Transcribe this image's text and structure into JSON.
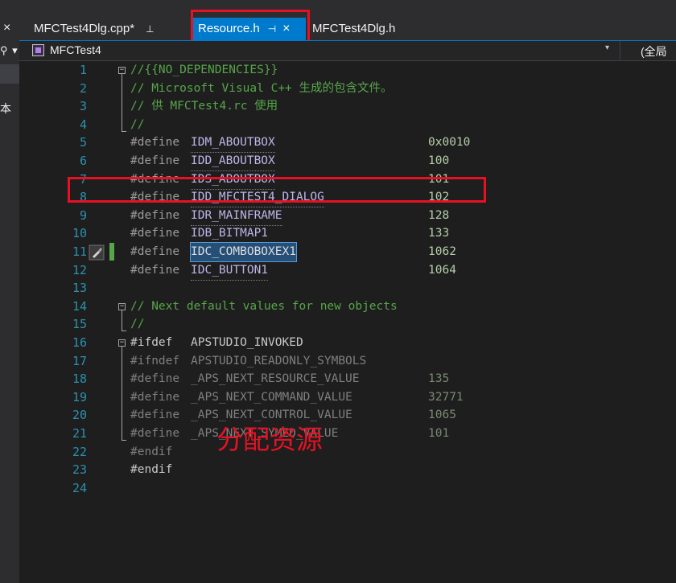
{
  "left_panel": {
    "close_glyph": "×",
    "search_glyph": "⚲ ▾",
    "partial_text": "本"
  },
  "tabs": [
    {
      "label": "MFCTest4Dlg.cpp*",
      "pin": "⊥",
      "active": false
    },
    {
      "label": "Resource.h",
      "pin": "⊣",
      "close": "×",
      "active": true
    },
    {
      "label": "MFCTest4Dlg.h",
      "active": false
    }
  ],
  "nav": {
    "project": "MFCTest4",
    "dropdown": "▾",
    "scope": "(全局范"
  },
  "code": [
    {
      "n": "1",
      "text": "//{{NO_DEPENDENCIES}}"
    },
    {
      "n": "2",
      "text": "// Microsoft Visual C++ 生成的包含文件。"
    },
    {
      "n": "3",
      "text": "// 供 MFCTest4.rc 使用"
    },
    {
      "n": "4",
      "text": "//"
    },
    {
      "n": "5",
      "kw": "#define",
      "name": "IDM_ABOUTBOX",
      "value": "0x0010"
    },
    {
      "n": "6",
      "kw": "#define",
      "name": "IDD_ABOUTBOX",
      "value": "100"
    },
    {
      "n": "7",
      "kw": "#define",
      "name": "IDS_ABOUTBOX",
      "value": "101"
    },
    {
      "n": "8",
      "kw": "#define",
      "name": "IDD_MFCTEST4_DIALOG",
      "value": "102"
    },
    {
      "n": "9",
      "kw": "#define",
      "name": "IDR_MAINFRAME",
      "value": "128"
    },
    {
      "n": "10",
      "kw": "#define",
      "name": "IDB_BITMAP1",
      "value": "133"
    },
    {
      "n": "11",
      "kw": "#define",
      "name": "IDC_COMBOBOXEX1",
      "value": "1062"
    },
    {
      "n": "12",
      "kw": "#define",
      "name": "IDC_BUTTON1",
      "value": "1064"
    },
    {
      "n": "13"
    },
    {
      "n": "14",
      "text": "// Next default values for new objects"
    },
    {
      "n": "15",
      "text": "//"
    },
    {
      "n": "16",
      "kw": "#ifdef",
      "name": "APSTUDIO_INVOKED"
    },
    {
      "n": "17",
      "kw": "#ifndef",
      "name": "APSTUDIO_READONLY_SYMBOLS"
    },
    {
      "n": "18",
      "kw": "#define",
      "name": "_APS_NEXT_RESOURCE_VALUE",
      "value": "135"
    },
    {
      "n": "19",
      "kw": "#define",
      "name": "_APS_NEXT_COMMAND_VALUE",
      "value": "32771"
    },
    {
      "n": "20",
      "kw": "#define",
      "name": "_APS_NEXT_CONTROL_VALUE",
      "value": "1065"
    },
    {
      "n": "21",
      "kw": "#define",
      "name": "_APS_NEXT_SYMED_VALUE",
      "value": "101"
    },
    {
      "n": "22",
      "kw": "#endif"
    },
    {
      "n": "23",
      "kw": "#endif"
    },
    {
      "n": "24"
    }
  ],
  "fold_glyph": "−",
  "annotation": "分配资源",
  "colors": {
    "accent": "#007acc",
    "highlight_box": "#e81123",
    "comment": "#57a64a",
    "macro": "#bdb6e9",
    "number": "#b5cea8",
    "line_number": "#2b91af"
  }
}
